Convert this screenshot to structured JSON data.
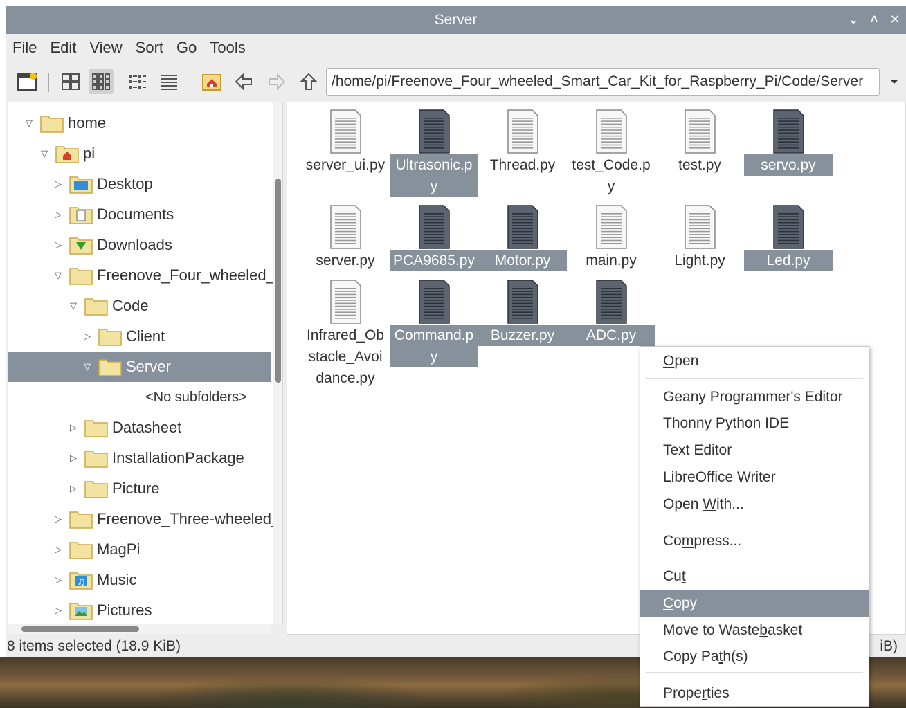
{
  "window": {
    "title": "Server"
  },
  "menu": [
    "File",
    "Edit",
    "View",
    "Sort",
    "Go",
    "Tools"
  ],
  "location": {
    "path": "/home/pi/Freenove_Four_wheeled_Smart_Car_Kit_for_Raspberry_Pi/Code/Server"
  },
  "tree": [
    {
      "label": "home",
      "expanded": true,
      "icon": "folder-icon"
    },
    {
      "label": "pi",
      "expanded": true,
      "icon": "home-folder-icon"
    },
    {
      "label": "Desktop",
      "expanded": false,
      "icon": "desktop-folder-icon"
    },
    {
      "label": "Documents",
      "expanded": false,
      "icon": "documents-folder-icon"
    },
    {
      "label": "Downloads",
      "expanded": false,
      "icon": "downloads-folder-icon"
    },
    {
      "label": "Freenove_Four_wheeled_S",
      "expanded": true,
      "icon": "folder-icon"
    },
    {
      "label": "Code",
      "expanded": true,
      "icon": "folder-icon"
    },
    {
      "label": "Client",
      "expanded": false,
      "icon": "folder-icon"
    },
    {
      "label": "Server",
      "expanded": true,
      "icon": "folder-icon"
    },
    {
      "label": "<No subfolders>",
      "expanded": null,
      "icon": ""
    },
    {
      "label": "Datasheet",
      "expanded": false,
      "icon": "folder-icon"
    },
    {
      "label": "InstallationPackage",
      "expanded": false,
      "icon": "folder-icon"
    },
    {
      "label": "Picture",
      "expanded": false,
      "icon": "folder-icon"
    },
    {
      "label": "Freenove_Three-wheeled_!",
      "expanded": false,
      "icon": "folder-icon"
    },
    {
      "label": "MagPi",
      "expanded": false,
      "icon": "folder-icon"
    },
    {
      "label": "Music",
      "expanded": false,
      "icon": "music-folder-icon"
    },
    {
      "label": "Pictures",
      "expanded": false,
      "icon": "pictures-folder-icon"
    }
  ],
  "files": [
    {
      "name": "server_ui.py",
      "display": "server_ui.py",
      "selected": false
    },
    {
      "name": "Ultrasonic.py",
      "display": "Ultrasonic.p\ny",
      "selected": true
    },
    {
      "name": "Thread.py",
      "display": "Thread.py",
      "selected": false
    },
    {
      "name": "test_Code.py",
      "display": "test_Code.p\ny",
      "selected": false
    },
    {
      "name": "test.py",
      "display": "test.py",
      "selected": false
    },
    {
      "name": "servo.py",
      "display": "servo.py",
      "selected": true
    },
    {
      "name": "server.py",
      "display": "server.py",
      "selected": false
    },
    {
      "name": "PCA9685.py",
      "display": "PCA9685.py",
      "selected": true
    },
    {
      "name": "Motor.py",
      "display": "Motor.py",
      "selected": true
    },
    {
      "name": "main.py",
      "display": "main.py",
      "selected": false
    },
    {
      "name": "Light.py",
      "display": "Light.py",
      "selected": false
    },
    {
      "name": "Led.py",
      "display": "Led.py",
      "selected": true
    },
    {
      "name": "Infrared_Obstacle_Avoidance.py",
      "display": "Infrared_Ob\nstacle_Avoi\ndance.py",
      "selected": false
    },
    {
      "name": "Command.py",
      "display": "Command.p\ny",
      "selected": true
    },
    {
      "name": "Buzzer.py",
      "display": "Buzzer.py",
      "selected": true
    },
    {
      "name": "ADC.py",
      "display": "ADC.py",
      "selected": true
    }
  ],
  "status": {
    "left": "8 items selected (18.9 KiB)",
    "right": "iB)"
  },
  "context_menu": {
    "items": [
      {
        "label": "Open",
        "underline_index": 0
      },
      {
        "label": "Geany Programmer's Editor"
      },
      {
        "label": "Thonny Python IDE"
      },
      {
        "label": "Text Editor"
      },
      {
        "label": "LibreOffice Writer"
      },
      {
        "label": "Open With...",
        "underline_index": 5
      },
      {
        "label": "Compress...",
        "underline_index": 2
      },
      {
        "label": "Cut",
        "underline_index": 2
      },
      {
        "label": "Copy",
        "underline_index": 0,
        "highlighted": true
      },
      {
        "label": "Move to Wastebasket",
        "underline_index": 13
      },
      {
        "label": "Copy Path(s)",
        "underline_index": 7
      },
      {
        "label": "Properties",
        "underline_index": 5
      }
    ]
  },
  "colors": {
    "selection": "#87919b",
    "titlebar": "#87919b",
    "window_bg": "#ededed",
    "folder": "#f3e3a0"
  }
}
